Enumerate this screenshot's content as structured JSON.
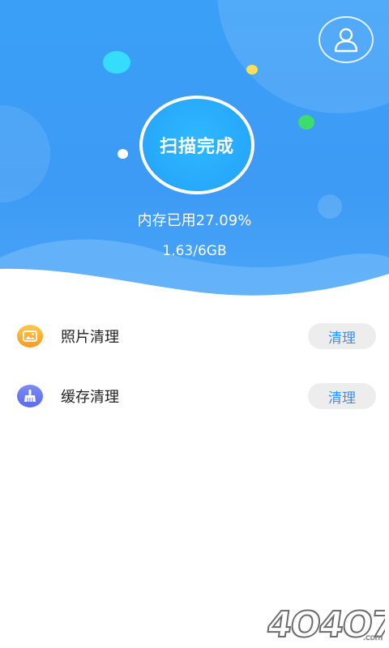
{
  "header": {
    "scan_status": "扫描完成",
    "memory_used_text": "内存已用27.09%",
    "memory_size_text": "1.63/6GB",
    "profile_icon": "user-icon"
  },
  "list": {
    "items": [
      {
        "label": "照片清理",
        "icon": "photo-icon",
        "button_label": "清理",
        "icon_color": "#f7a82a"
      },
      {
        "label": "缓存清理",
        "icon": "broom-icon",
        "button_label": "清理",
        "icon_color": "#6675ea"
      }
    ]
  },
  "colors": {
    "header_blue": "#3d9af5",
    "accent_text": "#3b8ff0",
    "button_bg": "#ededed"
  },
  "watermark": "4O4O7"
}
